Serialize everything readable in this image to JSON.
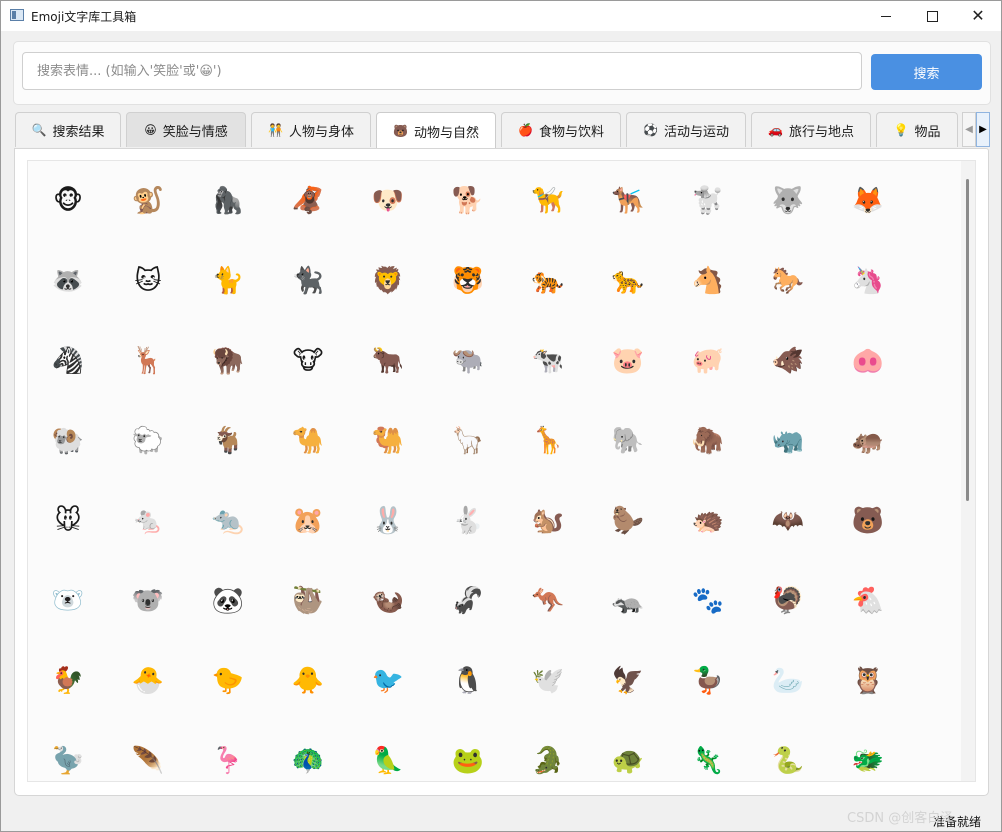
{
  "window": {
    "title": "Emoji文字库工具箱"
  },
  "search": {
    "placeholder": "搜索表情... (如输入'笑脸'或'😀')",
    "button_label": "搜索"
  },
  "tabs": [
    {
      "icon": "🔍",
      "label": "搜索结果"
    },
    {
      "icon": "😀",
      "label": "笑脸与情感"
    },
    {
      "icon": "🧑‍🤝‍🧑",
      "label": "人物与身体"
    },
    {
      "icon": "🐻",
      "label": "动物与自然"
    },
    {
      "icon": "🍎",
      "label": "食物与饮料"
    },
    {
      "icon": "⚽",
      "label": "活动与运动"
    },
    {
      "icon": "🚗",
      "label": "旅行与地点"
    },
    {
      "icon": "💡",
      "label": "物品"
    }
  ],
  "active_tab": "动物与自然",
  "emojis": [
    "🐵",
    "🐒",
    "🦍",
    "🦧",
    "🐶",
    "🐕",
    "🦮",
    "🐕‍🦺",
    "🐩",
    "🐺",
    "🦊",
    "🦝",
    "🐱",
    "🐈",
    "🐈‍⬛",
    "🦁",
    "🐯",
    "🐅",
    "🐆",
    "🐴",
    "🐎",
    "🦄",
    "🦓",
    "🦌",
    "🦬",
    "🐮",
    "🐂",
    "🐃",
    "🐄",
    "🐷",
    "🐖",
    "🐗",
    "🐽",
    "🐏",
    "🐑",
    "🐐",
    "🐪",
    "🐫",
    "🦙",
    "🦒",
    "🐘",
    "🦣",
    "🦏",
    "🦛",
    "🐭",
    "🐁",
    "🐀",
    "🐹",
    "🐰",
    "🐇",
    "🐿️",
    "🦫",
    "🦔",
    "🦇",
    "🐻",
    "🐻‍❄️",
    "🐨",
    "🐼",
    "🦥",
    "🦦",
    "🦨",
    "🦘",
    "🦡",
    "🐾",
    "🦃",
    "🐔",
    "🐓",
    "🐣",
    "🐤",
    "🐥",
    "🐦",
    "🐧",
    "🕊️",
    "🦅",
    "🦆",
    "🦢",
    "🦉",
    "🦤",
    "🪶",
    "🦩",
    "🦚",
    "🦜",
    "🐸",
    "🐊",
    "🐢",
    "🦎",
    "🐍",
    "🐲"
  ],
  "status": {
    "text": "准备就绪"
  },
  "watermark": "CSDN @创客白泽",
  "colors": {
    "accent": "#4a90e2"
  }
}
